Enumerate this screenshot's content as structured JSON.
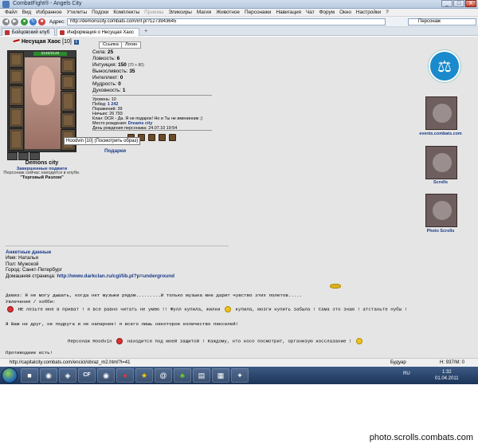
{
  "window": {
    "title": "CombatFight® - Angels City",
    "btn_min": "_",
    "btn_max": "□",
    "btn_close": "X"
  },
  "menu": [
    "Файл",
    "Вид",
    "Избранное",
    "Утилиты",
    "Подски",
    "Комплекты",
    "Приемы",
    "Эликсиры",
    "Магия",
    "Животное",
    "Персонажи",
    "Навигация",
    "Чат",
    "Форум",
    "Окно",
    "Настройки",
    "?"
  ],
  "toolbar": {
    "address_label": "Адрес:",
    "address": "http://demonscity.combats.com/inf.pl?1273943645",
    "search_placeholder": "Персонаж"
  },
  "tabs": [
    {
      "label": "Бойцовский клуб"
    },
    {
      "label": "Информация о Несущая Хаос"
    }
  ],
  "character": {
    "name": "Несущая Хаос",
    "level": "[10]",
    "hp": "2140/2140",
    "tooltip": "Hoodvin [10] (Посмотреть образ)",
    "city": "Demons city",
    "city_sub": "Завершенные подвиги",
    "location_text": "Персонаж сейчас находится в клубе.",
    "location_place": "\"Торговый Разлом\""
  },
  "buttons": {
    "link": "Ссылка",
    "login": "Логин"
  },
  "stats": [
    {
      "label": "Сила:",
      "value": "25",
      "add": ""
    },
    {
      "label": "Ловкость:",
      "value": "6",
      "add": ""
    },
    {
      "label": "Интуиция:",
      "value": "150",
      "add": "(70 + 80)"
    },
    {
      "label": "Выносливость:",
      "value": "35",
      "add": ""
    },
    {
      "label": "Интеллект:",
      "value": "0",
      "add": ""
    },
    {
      "label": "Мудрость:",
      "value": "0",
      "add": ""
    },
    {
      "label": "Духовность:",
      "value": "1",
      "add": ""
    }
  ],
  "meta": [
    {
      "text": "Уровень: 10",
      "blue": ""
    },
    {
      "text": "Побед: ",
      "blue": "1 242"
    },
    {
      "text": "Поражений: 39",
      "blue": ""
    },
    {
      "text": "Ничьих: 26 793",
      "blue": ""
    },
    {
      "text": "Клан: DCR - Да. Я не подарок! Но и Ты не именинник ;)",
      "blue": ""
    },
    {
      "text": "Место рождения: ",
      "blue": "Dreams city"
    },
    {
      "text": "День рождения персонажа: 24.07.10 19:54",
      "blue": ""
    }
  ],
  "gifts_label": "Подарки",
  "side": {
    "events": "events.combats.com",
    "scrolls": "Scrolls",
    "photo": "Photo Scrolls"
  },
  "profile": {
    "section": "Анкетные данные",
    "name": "Имя: Наталья",
    "sex": "Пол: Мужской",
    "city": "Город: Санкт-Петербург",
    "homepage_label": "Домашняя страница: ",
    "homepage": "http://www.darkclan.ru/cgi/lib.pl?p=underground"
  },
  "motto": {
    "line1": "Девиз: Я не могу дышать, когда нет музыки рядом.........И только музыка мне дарит чувство этих полетов.....",
    "line2": "Увлечения / хобби:",
    "line3a": "НЕ лезьте мне в приват ! я все равно читать не умею !! Фулл купила, жилки",
    "line3b": "купила, мозги купить забыла ! Сама это знаю ! атстаньте нубы !",
    "line4": "Я Вам не друг, не подруга и не напарник! я всего лишь некоторое количество пикселей!",
    "line5a": "Персонаж Hoodvin",
    "line5b": "находится под моей защитой ! Каждому, кто косо посмотрит, организую косслазание !",
    "line6": "Противодеие есть!"
  },
  "status": {
    "url": "http://capitalcity.combats.com/encicl/obraz_m2.html?l=41",
    "zone": "Будуар",
    "zoom": "Н: 937/М: 0"
  },
  "taskbar": {
    "lang": "RU",
    "time": "1:32",
    "date": "01.04.2011",
    "items": [
      "■",
      "◉",
      "◈",
      "CF",
      "◉",
      "●",
      "★",
      "@",
      "♣",
      "▤",
      "▦",
      "✦"
    ]
  },
  "watermark": "photo.scrolls.combats.com"
}
